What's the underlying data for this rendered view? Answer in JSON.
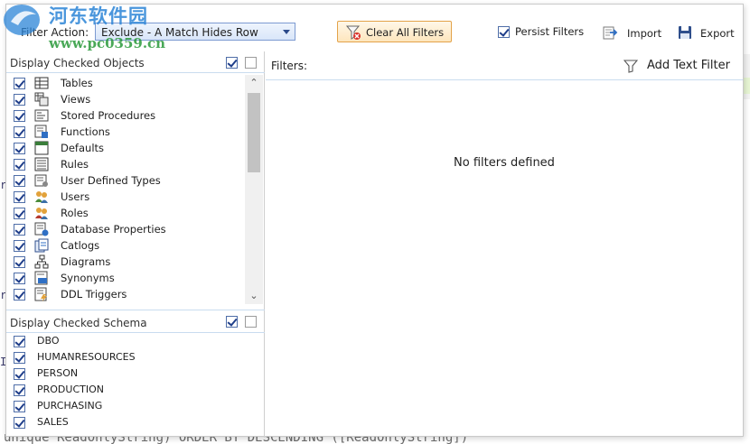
{
  "watermark": {
    "title": "河东软件园",
    "url": "www.pc0359.cn"
  },
  "toolbar": {
    "filter_action_label": "Filter Action:",
    "filter_action_value": "Exclude - A Match Hides Row",
    "clear_all_label": "Clear All Filters",
    "persist_label": "Persist Filters",
    "persist_checked": true,
    "import_label": "Import",
    "export_label": "Export"
  },
  "objects_section": {
    "title": "Display Checked Objects",
    "items": [
      {
        "label": "Tables",
        "icon": "table-icon",
        "checked": true
      },
      {
        "label": "Views",
        "icon": "view-icon",
        "checked": true
      },
      {
        "label": "Stored Procedures",
        "icon": "stored-procedure-icon",
        "checked": true
      },
      {
        "label": "Functions",
        "icon": "function-icon",
        "checked": true
      },
      {
        "label": "Defaults",
        "icon": "default-icon",
        "checked": true
      },
      {
        "label": "Rules",
        "icon": "rule-icon",
        "checked": true
      },
      {
        "label": "User Defined Types",
        "icon": "user-defined-type-icon",
        "checked": true
      },
      {
        "label": "Users",
        "icon": "users-icon",
        "checked": true
      },
      {
        "label": "Roles",
        "icon": "roles-icon",
        "checked": true
      },
      {
        "label": "Database Properties",
        "icon": "database-properties-icon",
        "checked": true
      },
      {
        "label": "Catlogs",
        "icon": "catalog-icon",
        "checked": true
      },
      {
        "label": "Diagrams",
        "icon": "diagram-icon",
        "checked": true
      },
      {
        "label": "Synonyms",
        "icon": "synonym-icon",
        "checked": true
      },
      {
        "label": "DDL Triggers",
        "icon": "ddl-trigger-icon",
        "checked": true
      }
    ]
  },
  "schema_section": {
    "title": "Display Checked Schema",
    "items": [
      {
        "label": "DBO",
        "checked": true
      },
      {
        "label": "HUMANRESOURCES",
        "checked": true
      },
      {
        "label": "PERSON",
        "checked": true
      },
      {
        "label": "PRODUCTION",
        "checked": true
      },
      {
        "label": "PURCHASING",
        "checked": true
      },
      {
        "label": "SALES",
        "checked": true
      }
    ]
  },
  "filters_pane": {
    "label": "Filters:",
    "add_text_filter_label": "Add Text Filter",
    "empty_message": "No filters defined"
  },
  "background": {
    "bottom_code": "unique_ReadOnlyString) ORDER BY DESCENDING ([ReadOnlyString])"
  },
  "colors": {
    "accent": "#2b4a8a",
    "clear_button_border": "#e3a34a",
    "divider": "#c9dcef"
  }
}
